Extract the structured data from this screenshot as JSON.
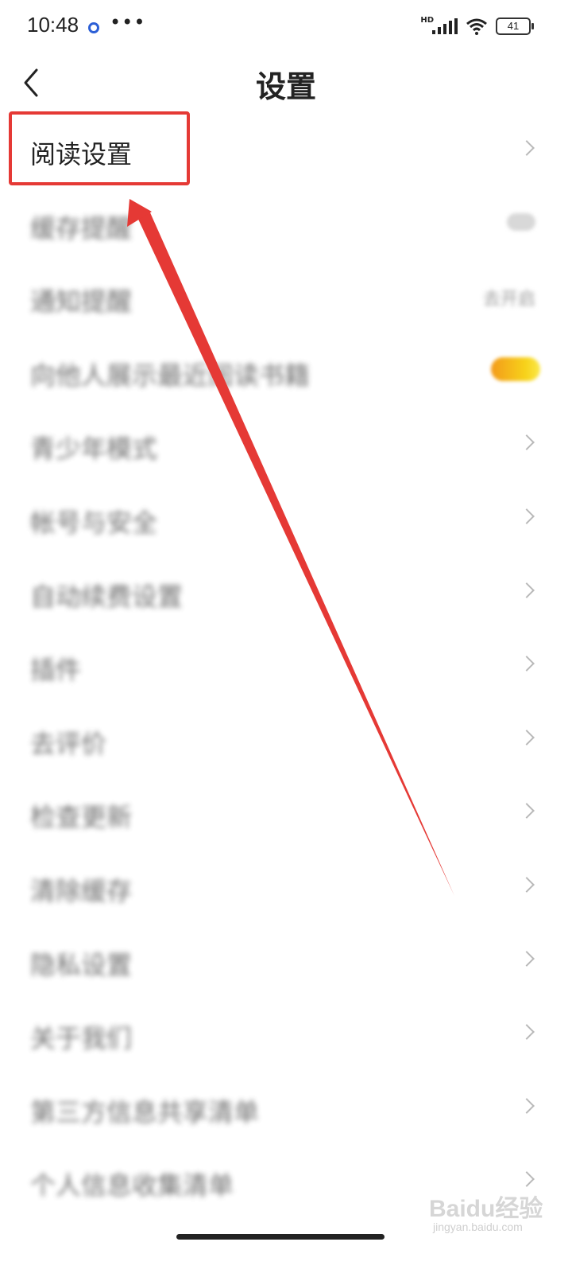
{
  "status_bar": {
    "time": "10:48",
    "more": "•••",
    "network": "HD",
    "battery": "41"
  },
  "header": {
    "title": "设置"
  },
  "items": [
    {
      "label": "阅读设置",
      "right": "chevron",
      "blurred": false
    },
    {
      "label": "缓存提醒",
      "right": "toggle",
      "blurred": true
    },
    {
      "label": "通知提醒",
      "right": "value",
      "value": "去开启",
      "blurred": true
    },
    {
      "label": "向他人展示最近阅读书籍",
      "right": "toggle-on",
      "blurred": true
    },
    {
      "label": "青少年模式",
      "right": "chevron",
      "blurred": true
    },
    {
      "label": "帐号与安全",
      "right": "chevron",
      "blurred": true
    },
    {
      "label": "自动续费设置",
      "right": "chevron",
      "blurred": true
    },
    {
      "label": "插件",
      "right": "chevron",
      "blurred": true
    },
    {
      "label": "去评价",
      "right": "chevron",
      "blurred": true
    },
    {
      "label": "检查更新",
      "right": "chevron",
      "blurred": true
    },
    {
      "label": "清除缓存",
      "right": "chevron",
      "blurred": true
    },
    {
      "label": "隐私设置",
      "right": "chevron",
      "blurred": true
    },
    {
      "label": "关于我们",
      "right": "chevron",
      "blurred": true
    },
    {
      "label": "第三方信息共享清单",
      "right": "chevron",
      "blurred": true
    },
    {
      "label": "个人信息收集清单",
      "right": "chevron",
      "blurred": true
    }
  ],
  "watermark": {
    "brand": "Baidu经验",
    "url": "jingyan.baidu.com"
  },
  "colors": {
    "annotation": "#e53935",
    "chevron": "#b9b9b9",
    "toggle_on": "#f7c21a"
  }
}
